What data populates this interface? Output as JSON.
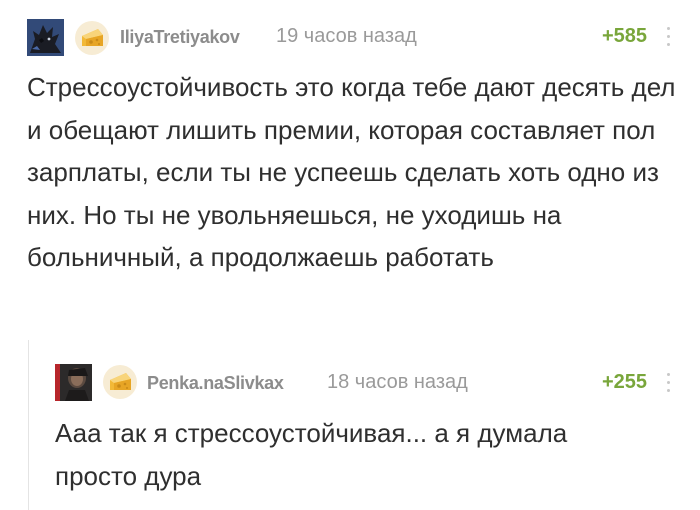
{
  "comments": [
    {
      "username": "IliyaTretiyakov",
      "time": "19 часов назад",
      "rating": "+585",
      "text": "Стрессоустойчивость это когда тебе дают десять дел и обещают лишить премии, которая составляет пол зарплаты, если ты не успеешь сделать хоть одно из них. Но ты не увольняешься, не уходишь на больничный, а продолжаешь работать",
      "avatar_icon": "dark-creature-avatar",
      "badge_icon": "cheese-icon"
    },
    {
      "username": "Penka.naSlivkax",
      "time": "18 часов назад",
      "rating": "+255",
      "text": "Ааа так я стрессоустойчивая... а я думала просто дура",
      "avatar_icon": "dark-photo-avatar",
      "badge_icon": "cheese-icon"
    }
  ],
  "colors": {
    "rating": "#79a63b",
    "username": "#8c8c8c",
    "meta": "#9a9a9a",
    "text": "#2f2f2f",
    "thread_line": "#e4e4e4"
  }
}
